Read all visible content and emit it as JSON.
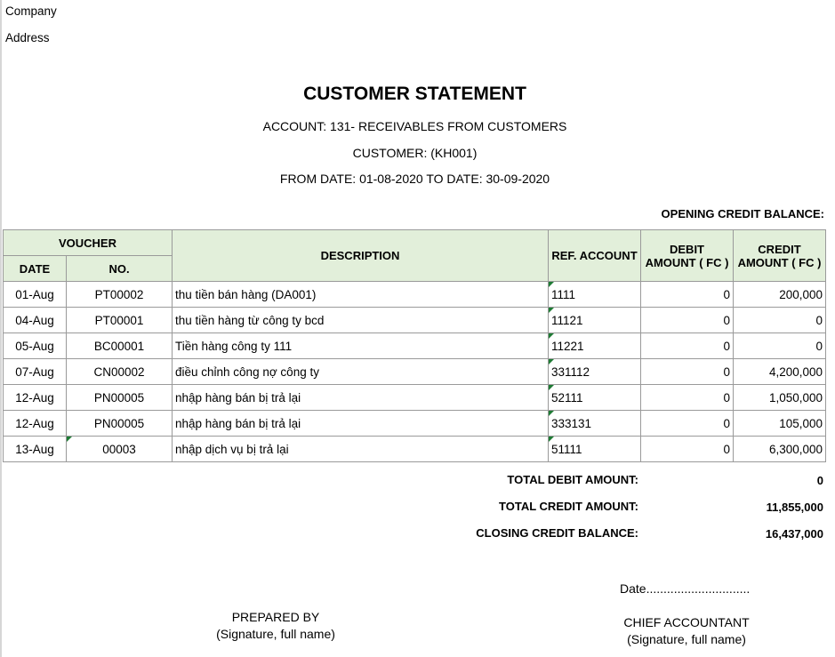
{
  "header": {
    "company_label": "Company",
    "address_label": "Address",
    "title": "CUSTOMER STATEMENT",
    "account": "ACCOUNT: 131- RECEIVABLES FROM CUSTOMERS",
    "customer": "CUSTOMER:  (KH001)",
    "period": "FROM DATE: 01-08-2020 TO DATE: 30-09-2020",
    "opening_balance_label": "OPENING CREDIT BALANCE:"
  },
  "table": {
    "headers": {
      "voucher": "VOUCHER",
      "date": "DATE",
      "no": "NO.",
      "description": "DESCRIPTION",
      "ref_account": "REF. ACCOUNT",
      "debit_l1": "DEBIT",
      "debit_l2": "AMOUNT ( FC )",
      "credit_l1": "CREDIT",
      "credit_l2": "AMOUNT ( FC )"
    },
    "rows": [
      {
        "date": "01-Aug",
        "no": "PT00002",
        "description": "thu tiền bán hàng (DA001)",
        "ref": "1111",
        "debit": "0",
        "credit": "200,000"
      },
      {
        "date": "04-Aug",
        "no": "PT00001",
        "description": "thu tiền hàng từ công ty bcd",
        "ref": "11121",
        "debit": "0",
        "credit": "0"
      },
      {
        "date": "05-Aug",
        "no": "BC00001",
        "description": "Tiền hàng công ty 111",
        "ref": "11221",
        "debit": "0",
        "credit": "0"
      },
      {
        "date": "07-Aug",
        "no": "CN00002",
        "description": "điều chỉnh công nợ công ty",
        "ref": "331112",
        "debit": "0",
        "credit": "4,200,000"
      },
      {
        "date": "12-Aug",
        "no": "PN00005",
        "description": "nhập hàng bán bị trả lại",
        "ref": "52111",
        "debit": "0",
        "credit": "1,050,000"
      },
      {
        "date": "12-Aug",
        "no": "PN00005",
        "description": "nhập hàng bán bị trả lại",
        "ref": "333131",
        "debit": "0",
        "credit": "105,000"
      },
      {
        "date": "13-Aug",
        "no": "00003",
        "description": "nhập dịch vụ bị trả lại",
        "ref": "51111",
        "debit": "0",
        "credit": "6,300,000"
      }
    ]
  },
  "totals": {
    "total_debit_label": "TOTAL DEBIT AMOUNT:",
    "total_debit_value": "0",
    "total_credit_label": "TOTAL CREDIT AMOUNT:",
    "total_credit_value": "11,855,000",
    "closing_label": "CLOSING CREDIT BALANCE:",
    "closing_value": "16,437,000"
  },
  "signatures": {
    "date_line": "Date..............................",
    "prepared_by": "PREPARED BY",
    "prepared_note": "(Signature, full name)",
    "chief_accountant": "CHIEF ACCOUNTANT",
    "chief_note": "(Signature, full name)"
  },
  "colors": {
    "header_bg": "#e2efda",
    "cell_marker": "#1e7b34"
  }
}
